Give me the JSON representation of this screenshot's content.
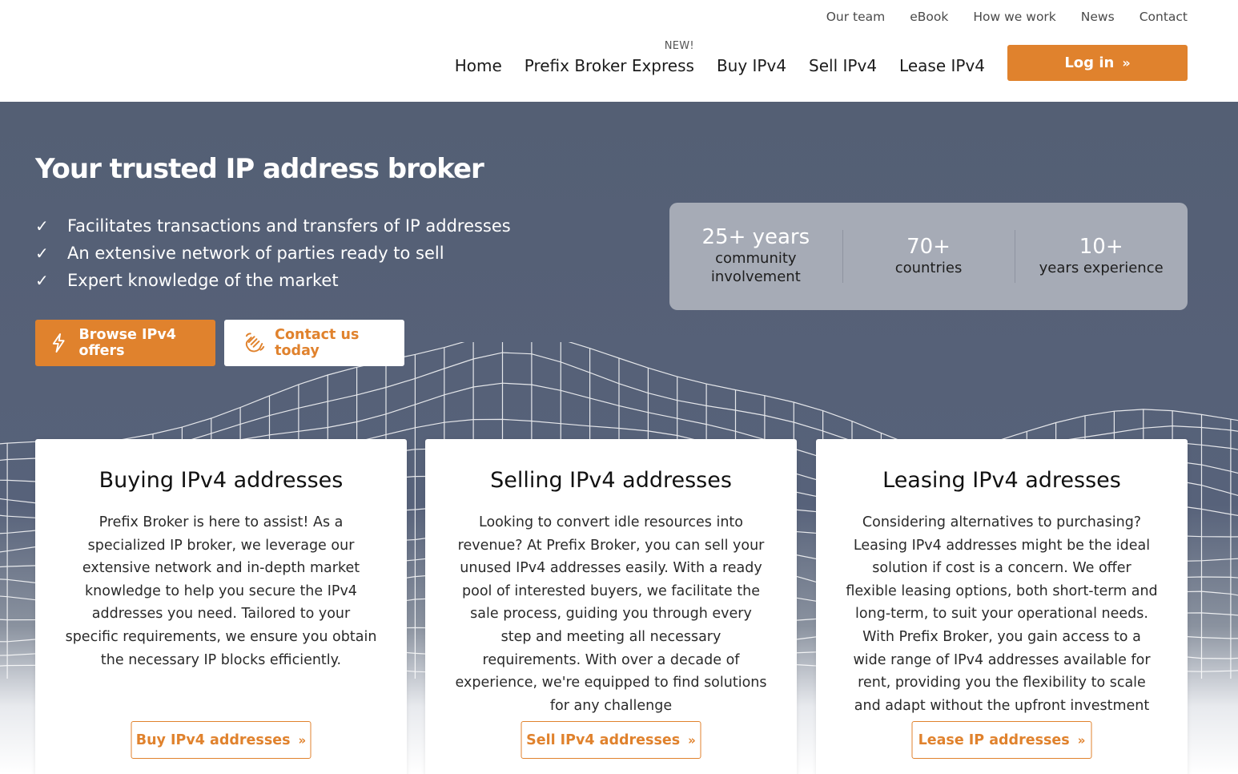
{
  "header": {
    "top_nav": [
      "Our team",
      "eBook",
      "How we work",
      "News",
      "Contact"
    ],
    "main_nav": [
      {
        "label": "Home",
        "badge": ""
      },
      {
        "label": "Prefix Broker Express",
        "badge": "NEW!"
      },
      {
        "label": "Buy IPv4",
        "badge": ""
      },
      {
        "label": "Sell IPv4",
        "badge": ""
      },
      {
        "label": "Lease IPv4",
        "badge": ""
      }
    ],
    "login_label": "Log in",
    "chevron": "»"
  },
  "hero": {
    "title": "Your trusted IP address broker",
    "bullets": [
      "Facilitates transactions and transfers of IP addresses",
      "An extensive network of parties ready to sell",
      "Expert knowledge of the market"
    ],
    "check_glyph": "✓",
    "browse_label": "Browse IPv4 offers",
    "contact_label": "Contact us today",
    "stats": [
      {
        "num": "25+ years",
        "label": "community involvement"
      },
      {
        "num": "70+",
        "label": "countries"
      },
      {
        "num": "10+",
        "label": "years experience"
      }
    ]
  },
  "cards": [
    {
      "title": "Buying IPv4 addresses",
      "text": "Prefix Broker is here to assist! As a specialized IP broker, we leverage our extensive network and in-depth market knowledge to help you secure the IPv4 addresses you need. Tailored to your specific requirements, we ensure you obtain the necessary IP blocks efficiently.",
      "cta": "Buy IPv4 addresses"
    },
    {
      "title": "Selling IPv4 addresses",
      "text": "Looking to convert idle resources into revenue? At Prefix Broker, you can sell your unused IPv4 addresses easily. With a ready pool of interested buyers, we facilitate the sale process, guiding you through every step and meeting all necessary requirements. With over a decade of experience, we're equipped to find solutions for any challenge",
      "cta": "Sell IPv4 addresses"
    },
    {
      "title": "Leasing IPv4 adresses",
      "text": "Considering alternatives to purchasing? Leasing IPv4 addresses might be the ideal solution if cost is a concern. We offer flexible leasing options, both short-term and long-term, to suit your operational needs. With Prefix Broker, you gain access to a wide range of IPv4 addresses available for rent, providing you the flexibility to scale and adapt without the upfront investment",
      "cta": "Lease IP addresses"
    }
  ],
  "colors": {
    "accent": "#e0822d",
    "hero_bg": "#545f74",
    "stats_bg": "#a6abb6"
  }
}
